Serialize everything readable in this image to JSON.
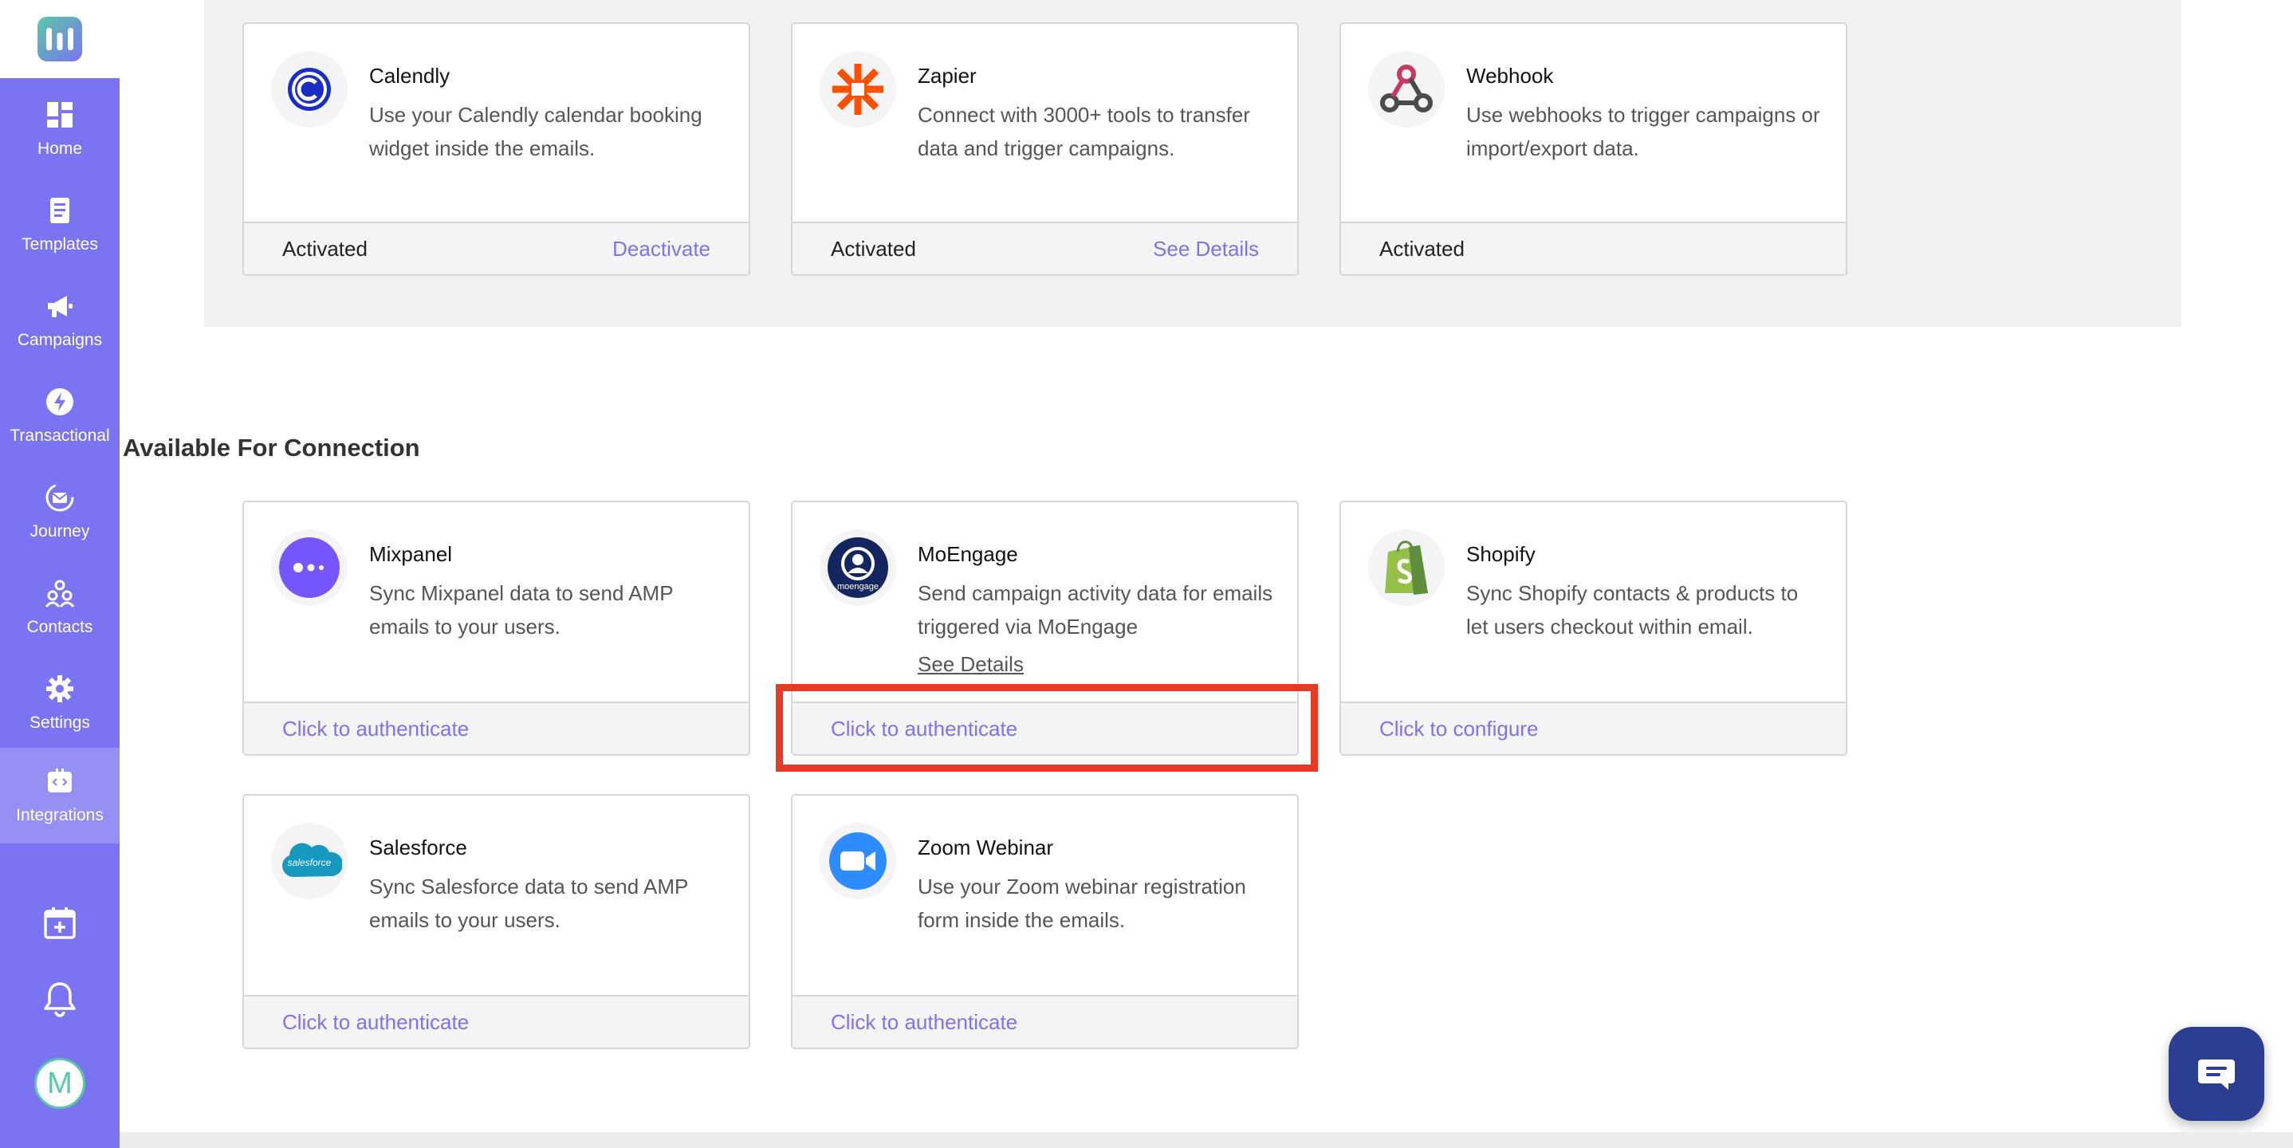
{
  "nav": [
    {
      "label": "Home",
      "icon": "dashboard-icon"
    },
    {
      "label": "Templates",
      "icon": "document-icon"
    },
    {
      "label": "Campaigns",
      "icon": "megaphone-icon"
    },
    {
      "label": "Transactional",
      "icon": "bolt-icon"
    },
    {
      "label": "Journey",
      "icon": "journey-mail-icon"
    },
    {
      "label": "Contacts",
      "icon": "people-icon"
    },
    {
      "label": "Settings",
      "icon": "gear-icon"
    },
    {
      "label": "Integrations",
      "icon": "code-icon",
      "active": true
    }
  ],
  "user": {
    "initial": "M"
  },
  "section": {
    "available_title": "Available For Connection"
  },
  "connected": [
    {
      "name": "Calendly",
      "desc": "Use your Calendly calendar booking widget inside the emails.",
      "status": "Activated",
      "action": "Deactivate",
      "icon": "calendly-icon"
    },
    {
      "name": "Zapier",
      "desc": "Connect with 3000+ tools to transfer data and trigger campaigns.",
      "status": "Activated",
      "action": "See Details",
      "icon": "zapier-icon"
    },
    {
      "name": "Webhook",
      "desc": "Use webhooks to trigger campaigns or import/export data.",
      "status": "Activated",
      "action": "",
      "icon": "webhook-icon"
    }
  ],
  "available": [
    {
      "name": "Mixpanel",
      "desc": "Sync Mixpanel data to send AMP emails to your users.",
      "action": "Click to authenticate",
      "icon": "mixpanel-icon"
    },
    {
      "name": "MoEngage",
      "desc": "Send campaign activity data for emails triggered via MoEngage",
      "details": "See Details",
      "action": "Click to authenticate",
      "icon": "moengage-icon",
      "logo_text": "moengage"
    },
    {
      "name": "Shopify",
      "desc": "Sync Shopify contacts & products to let users checkout within email.",
      "action": "Click to configure",
      "icon": "shopify-icon"
    },
    {
      "name": "Salesforce",
      "desc": "Sync Salesforce data to send AMP emails to your users.",
      "action": "Click to authenticate",
      "icon": "salesforce-icon",
      "logo_text": "salesforce"
    },
    {
      "name": "Zoom Webinar",
      "desc": "Use your Zoom webinar registration form inside the emails.",
      "action": "Click to authenticate",
      "icon": "zoom-icon"
    }
  ],
  "colors": {
    "accent": "#7b74f2",
    "highlight": "#e53a24",
    "chat": "#2c3e91"
  }
}
